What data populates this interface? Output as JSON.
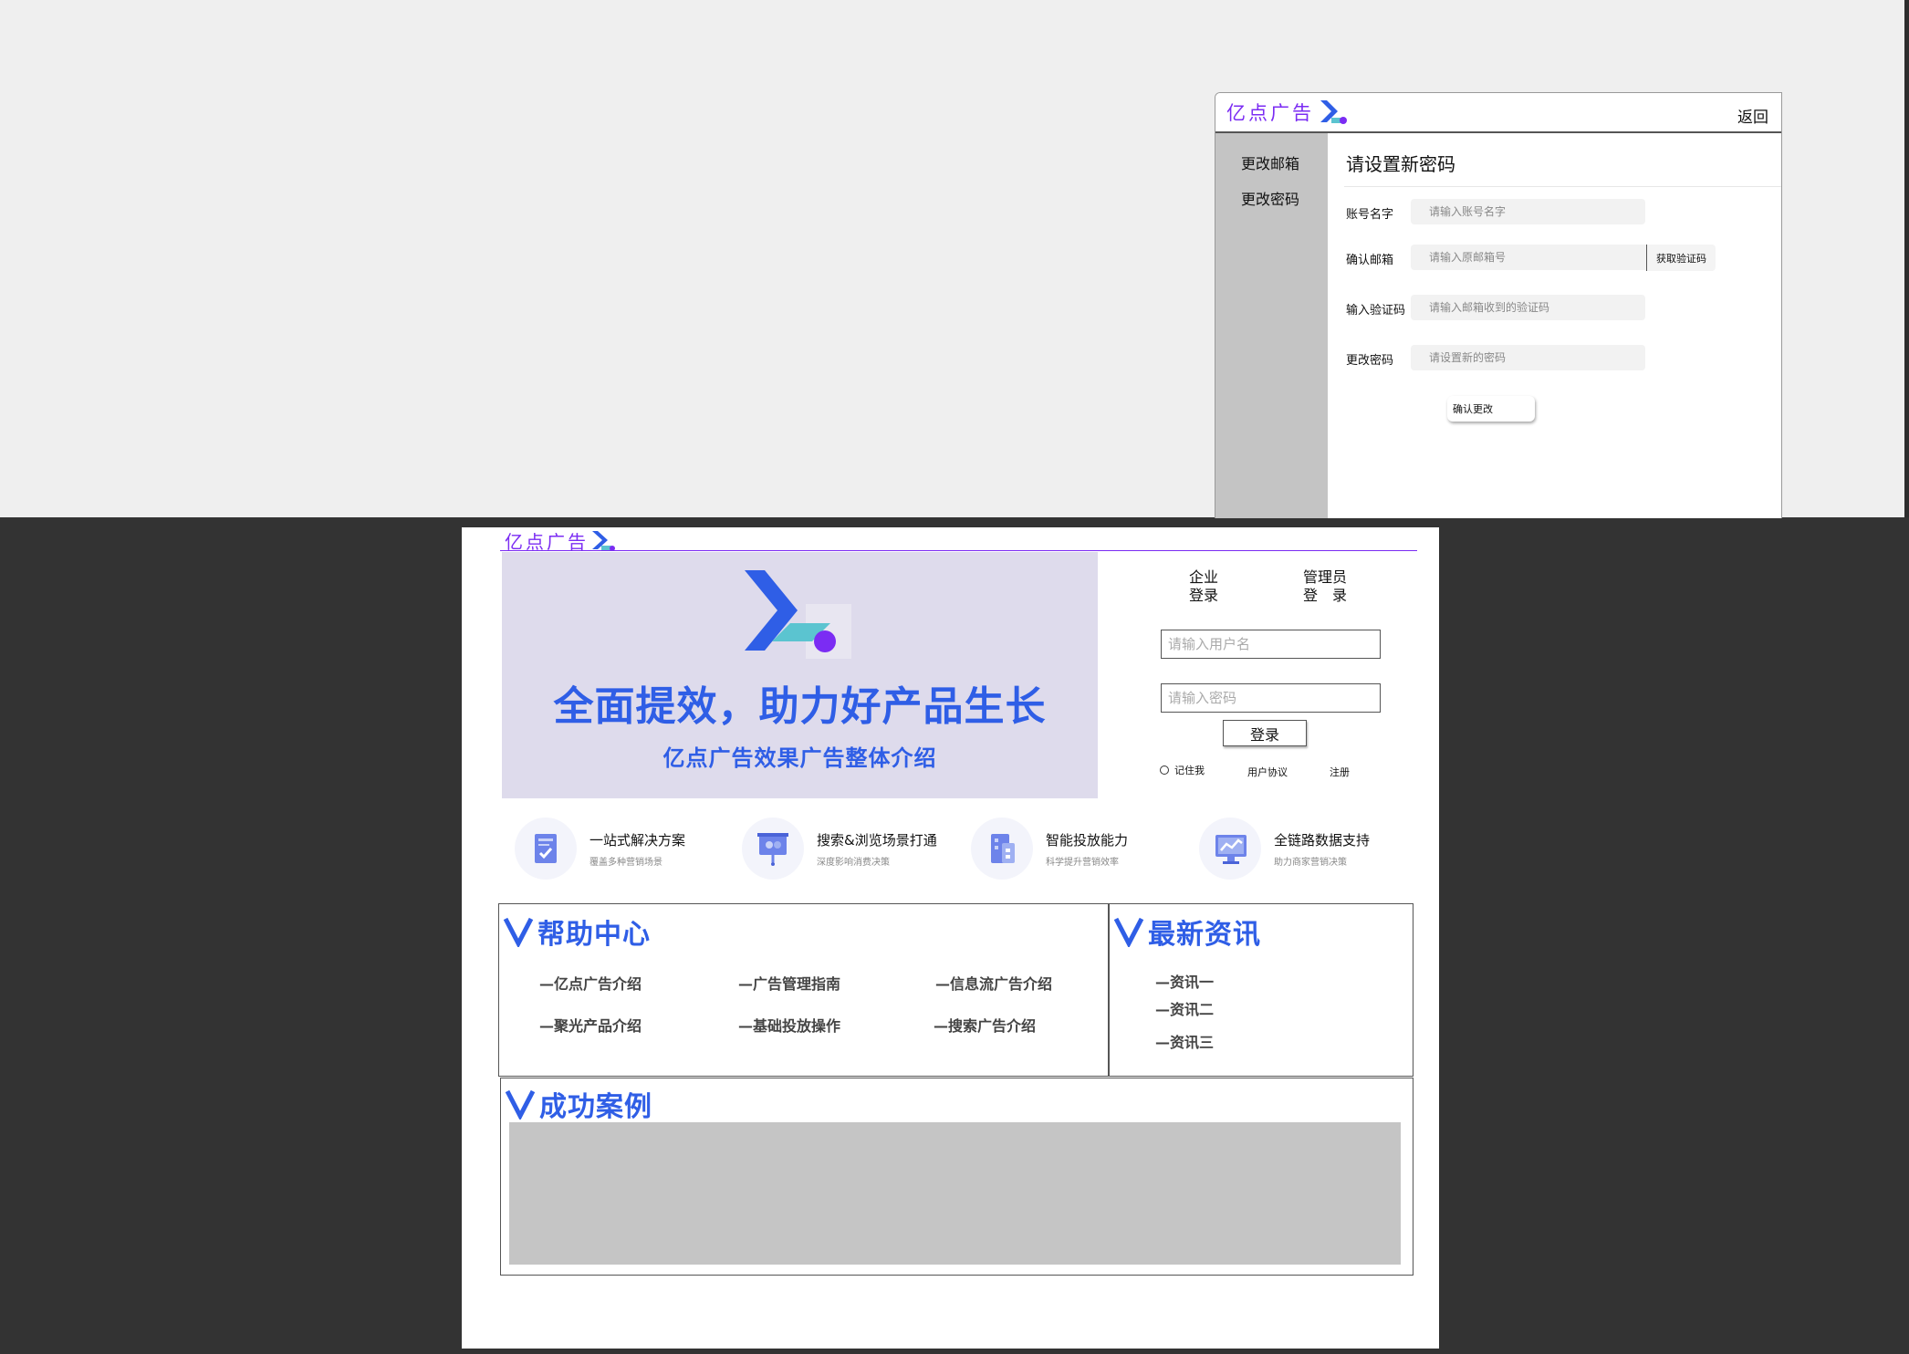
{
  "brand": {
    "logo_text": "亿点广告"
  },
  "settings": {
    "back_label": "返回",
    "sidebar": [
      {
        "label": "更改邮箱"
      },
      {
        "label": "更改密码"
      }
    ],
    "title": "请设置新密码",
    "fields": [
      {
        "label": "账号名字",
        "placeholder": "请输入账号名字",
        "value": ""
      },
      {
        "label": "确认邮箱",
        "placeholder": "请输入原邮箱号",
        "value": ""
      },
      {
        "label": "输入验证码",
        "placeholder": "请输入邮箱收到的验证码",
        "value": ""
      },
      {
        "label": "更改密码",
        "placeholder": "请设置新的密码",
        "value": ""
      }
    ],
    "get_code_label": "获取验证码",
    "confirm_label": "确认更改"
  },
  "home": {
    "banner": {
      "headline": "全面提效，助力好产品生长",
      "subline": "亿点广告效果广告整体介绍"
    },
    "login": {
      "tabs": [
        {
          "line1": "企业",
          "line2": "登录"
        },
        {
          "line1": "管理员",
          "line2": "登　录"
        }
      ],
      "username_placeholder": "请输入用户名",
      "password_placeholder": "请输入密码",
      "username_value": "",
      "password_value": "",
      "login_label": "登录",
      "remember_label": "记住我",
      "agreement_label": "用户协议",
      "register_label": "注册"
    },
    "features": [
      {
        "title": "一站式解决方案",
        "desc": "覆盖多种营销场景",
        "icon": "document-check-icon"
      },
      {
        "title": "搜索&浏览场景打通",
        "desc": "深度影响消费决策",
        "icon": "presentation-board-icon"
      },
      {
        "title": "智能投放能力",
        "desc": "科学提升营销效率",
        "icon": "building-grid-icon"
      },
      {
        "title": "全链路数据支持",
        "desc": "助力商家营销决策",
        "icon": "monitor-chart-icon"
      }
    ],
    "help_center": {
      "title": "帮助中心",
      "links": [
        "—亿点广告介绍",
        "—广告管理指南",
        "—信息流广告介绍",
        "—聚光产品介绍",
        "—基础投放操作",
        "—搜索广告介绍"
      ]
    },
    "news": {
      "title": "最新资讯",
      "items": [
        "—资讯一",
        "—资讯二",
        "—资讯三"
      ]
    },
    "cases": {
      "title": "成功案例"
    }
  },
  "colors": {
    "accent": "#2f5ee6",
    "brand_purple": "#7b2cf3",
    "teal": "#5bc4d0",
    "banner_bg": "#dedbec",
    "sidebar_bg": "#c4c4c4"
  }
}
